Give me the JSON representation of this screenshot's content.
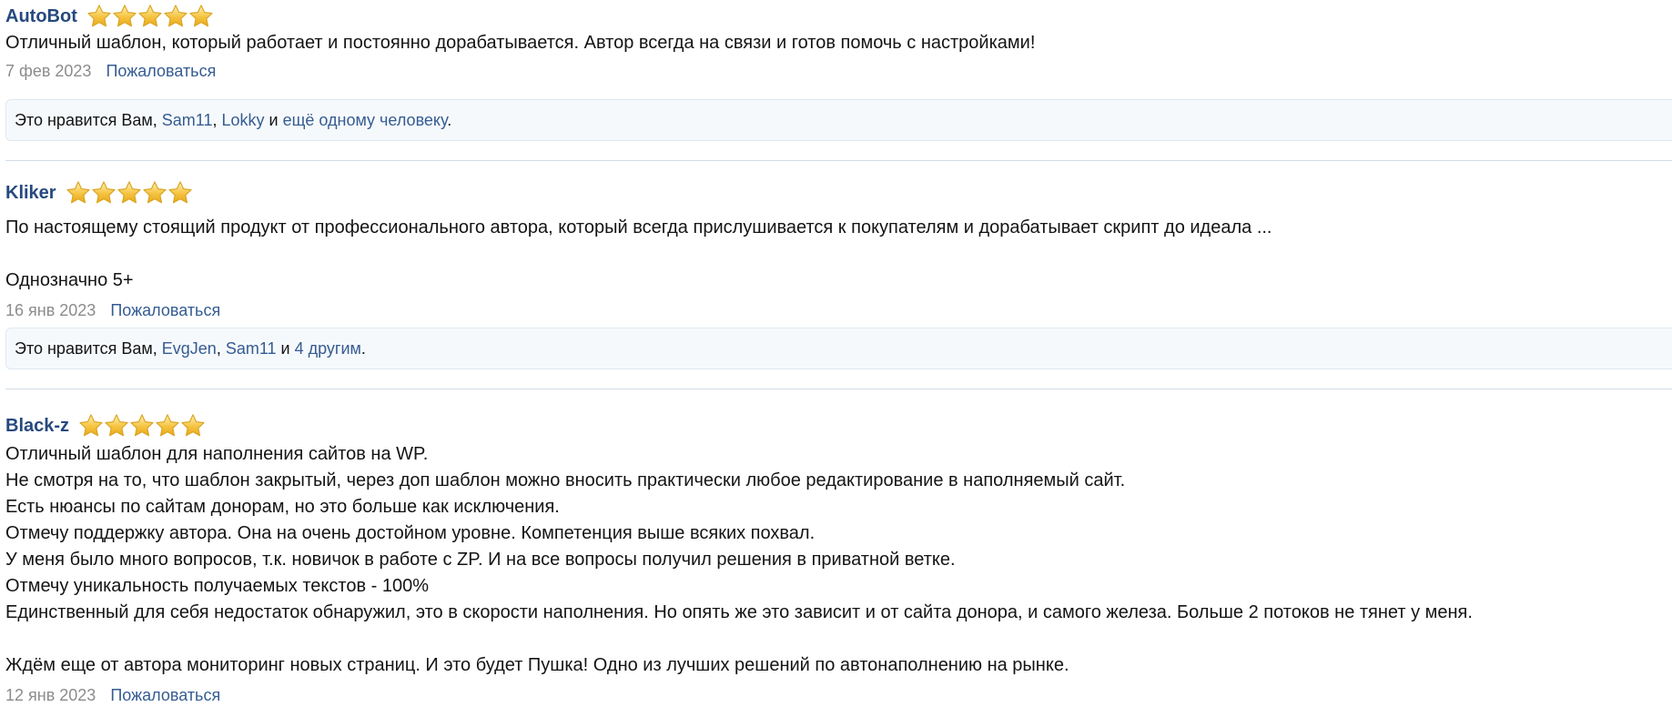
{
  "reviews": [
    {
      "author": "AutoBot",
      "rating": 5,
      "body": [
        "Отличный шаблон, который работает и постоянно дорабатывается. Автор всегда на связи и готов помочь с настройками!"
      ],
      "date": "7 фев 2023",
      "report_label": "Пожаловаться",
      "likes": {
        "prefix": "Это нравится Вам, ",
        "user1": "Sam11",
        "sep": ", ",
        "user2": "Lokky",
        "conj": " и ",
        "more": "ещё одному человеку",
        "suffix": "."
      }
    },
    {
      "author": "Kliker",
      "rating": 5,
      "body": [
        "По настоящему стоящий продукт от профессионального автора, который всегда прислушивается к покупателям и дорабатывает скрипт до идеала ...",
        "",
        "Однозначно 5+"
      ],
      "date": "16 янв 2023",
      "report_label": "Пожаловаться",
      "likes": {
        "prefix": "Это нравится Вам, ",
        "user1": "EvgJen",
        "sep": ", ",
        "user2": "Sam11",
        "conj": " и ",
        "more": "4 другим",
        "suffix": "."
      }
    },
    {
      "author": "Black-z",
      "rating": 5,
      "body": [
        "Отличный шаблон для наполнения сайтов на WP.",
        "Не смотря на то, что шаблон закрытый, через доп шаблон можно вносить практически любое редактирование в наполняемый сайт.",
        "Есть нюансы по сайтам донорам, но это больше как исключения.",
        "Отмечу поддержку автора. Она на очень достойном уровне. Компетенция выше всяких похвал.",
        "У меня было много вопросов, т.к. новичок в работе с ZP. И на все вопросы получил решения в приватной ветке.",
        "Отмечу уникальность получаемых текстов - 100%",
        "Единственный для себя недостаток обнаружил, это в скорости наполнения. Но опять же это зависит и от сайта донора, и самого железа. Больше 2 потоков не тянет у меня.",
        "",
        "Ждём еще от автора мониторинг новых страниц. И это будет Пушка! Одно из лучших решений по автонаполнению на рынке."
      ],
      "date": "12 янв 2023",
      "report_label": "Пожаловаться"
    }
  ],
  "colors": {
    "author": "#26497f",
    "link": "#355c92",
    "date": "#8c8c8c",
    "likes_bg": "#f6f9fc",
    "star_fill": "#f6c443",
    "star_stroke": "#d9a521"
  },
  "icons": {
    "star": "star-icon"
  }
}
